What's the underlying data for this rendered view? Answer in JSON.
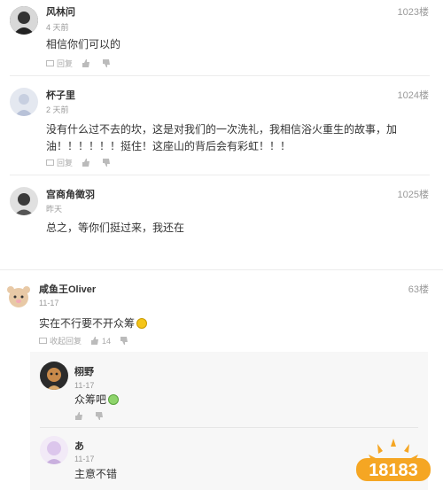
{
  "comments": [
    {
      "user": "风林问",
      "floor": "1023楼",
      "time": "4 天前",
      "text": "相信你们可以的",
      "reply_label": "回复"
    },
    {
      "user": "杯子里",
      "floor": "1024楼",
      "time": "2 天前",
      "text_line1": "没有什么过不去的坎，这是对我们的一次洗礼，我相信浴火重生的故事，加",
      "text_line2": "油！！！！！！挺住！这座山的背后会有彩虹！！！",
      "reply_label": "回复"
    },
    {
      "user": "宫商角徵羽",
      "floor": "1025楼",
      "time": "昨天",
      "text": "总之，等你们挺过来，我还在"
    },
    {
      "user": "咸鱼王Oliver",
      "floor": "63楼",
      "time": "11-17",
      "text": "实在不行要不开众筹",
      "collapse_label": "收起回复",
      "like_count": "14"
    }
  ],
  "replies": [
    {
      "user": "栩野",
      "time": "11-17",
      "text": "众筹吧"
    },
    {
      "user": "あ",
      "time": "11-17",
      "text": "主意不错"
    }
  ],
  "colors": {
    "text": "#333333",
    "meta": "#999999",
    "reply_bg": "#f7f7f7",
    "logo_orange": "#f5a623"
  },
  "icons": [
    "reply-icon",
    "thumbs-up-icon",
    "thumbs-down-icon",
    "grin-emoji-icon"
  ]
}
